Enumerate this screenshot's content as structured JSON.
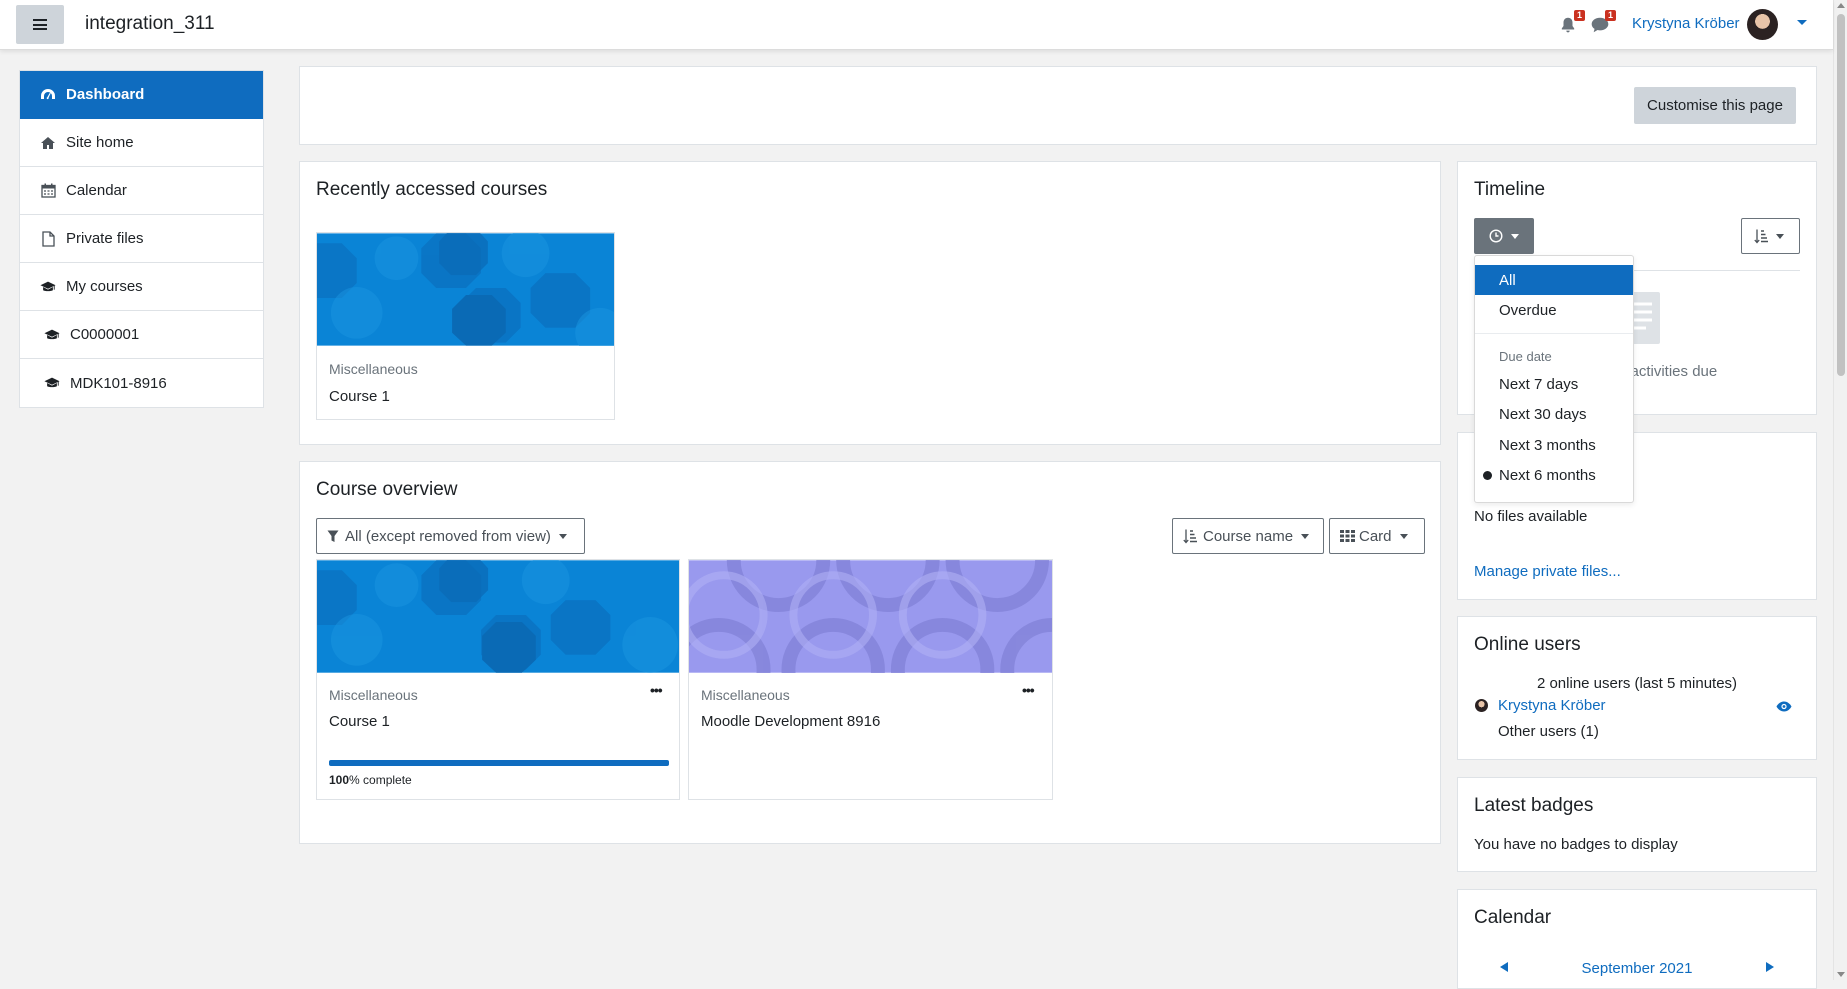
{
  "navbar": {
    "site_name": "integration_311",
    "notifications_count": "1",
    "messages_count": "1",
    "user_name": "Krystyna Kröber"
  },
  "sidebar": {
    "items": [
      {
        "label": "Dashboard",
        "icon": "dashboard-icon",
        "active": true
      },
      {
        "label": "Site home",
        "icon": "home-icon"
      },
      {
        "label": "Calendar",
        "icon": "calendar-icon"
      },
      {
        "label": "Private files",
        "icon": "file-icon"
      },
      {
        "label": "My courses",
        "icon": "graduation-cap-icon"
      },
      {
        "label": "C0000001",
        "icon": "graduation-cap-icon"
      },
      {
        "label": "MDK101-8916",
        "icon": "graduation-cap-icon"
      }
    ]
  },
  "page": {
    "customise_button": "Customise this page"
  },
  "recent": {
    "title": "Recently accessed courses",
    "courses": [
      {
        "category": "Miscellaneous",
        "name": "Course 1"
      }
    ]
  },
  "overview": {
    "title": "Course overview",
    "filter_label": "All (except removed from view)",
    "sort_label": "Course name",
    "view_label": "Card",
    "courses": [
      {
        "category": "Miscellaneous",
        "name": "Course 1",
        "progress_pct": "100",
        "progress_suffix": "% complete",
        "progress_value": 1.0
      },
      {
        "category": "Miscellaneous",
        "name": "Moodle Development 8916"
      }
    ]
  },
  "timeline": {
    "title": "Timeline",
    "empty_text": "g activities due",
    "menu": {
      "items_top": [
        "All",
        "Overdue"
      ],
      "header": "Due date",
      "items_due": [
        "Next 7 days",
        "Next 30 days",
        "Next 3 months",
        "Next 6 months"
      ],
      "selected_due": "Next 6 months"
    }
  },
  "private_files": {
    "empty_text": "No files available",
    "manage_link": "Manage private files..."
  },
  "online_users": {
    "title": "Online users",
    "summary": "2 online users (last 5 minutes)",
    "user": "Krystyna Kröber",
    "other": "Other users (1)"
  },
  "badges": {
    "title": "Latest badges",
    "empty_text": "You have no badges to display"
  },
  "calendar": {
    "title": "Calendar",
    "month": "September 2021"
  },
  "colors": {
    "brand": "#0f6cbf",
    "course1_image": "#0a84d6",
    "course2_image": "#9999ee"
  }
}
